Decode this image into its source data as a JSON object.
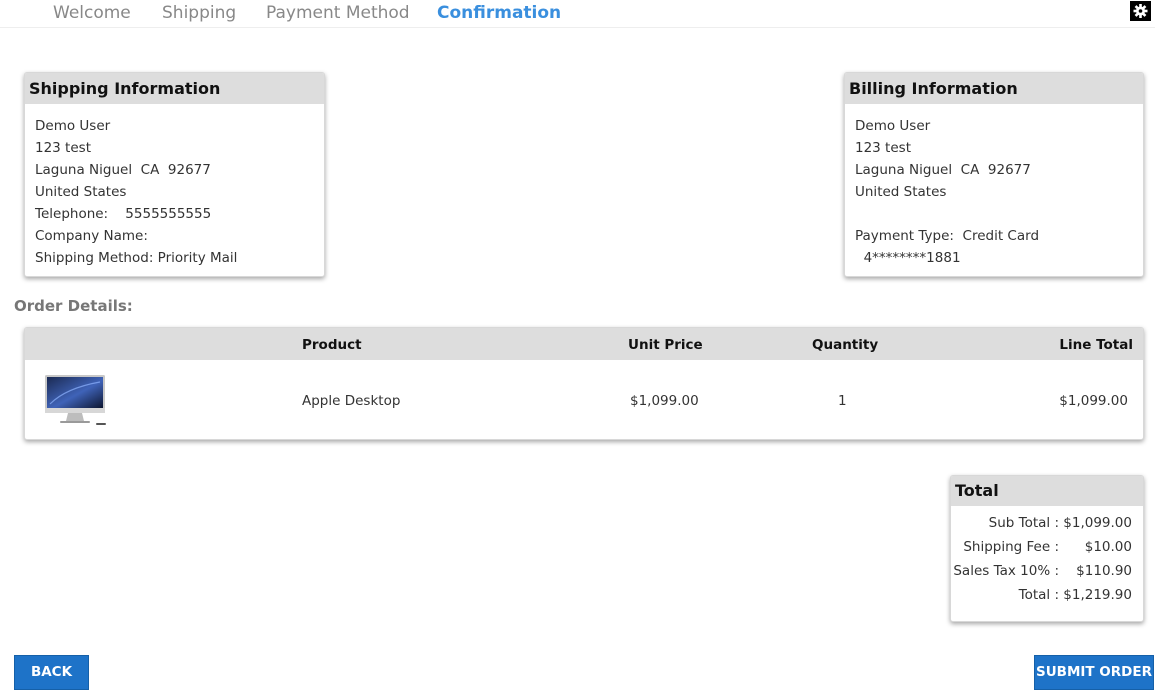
{
  "steps": [
    {
      "label": "Welcome",
      "active": false
    },
    {
      "label": "Shipping",
      "active": false
    },
    {
      "label": "Payment Method",
      "active": false
    },
    {
      "label": "Confirmation",
      "active": true
    }
  ],
  "header": {
    "settings_icon": "gear-icon"
  },
  "shipping": {
    "title": "Shipping Information",
    "name": "Demo User",
    "address": "123 test",
    "city_state_zip": "Laguna Niguel  CA  92677",
    "country": "United States",
    "telephone_label": "Telephone:",
    "telephone": "5555555555",
    "company_label": "Company Name:",
    "company": "",
    "method_label": "Shipping Method:",
    "method": "Priority Mail"
  },
  "billing": {
    "title": "Billing Information",
    "name": "Demo User",
    "address": "123 test",
    "city_state_zip": "Laguna Niguel  CA  92677",
    "country": "United States",
    "payment_type_label": "Payment Type:",
    "payment_type": "Credit Card",
    "card_number": "4********1881"
  },
  "order": {
    "title": "Order Details:",
    "columns": [
      "Product",
      "Unit Price",
      "Quantity",
      "Line Total"
    ],
    "rows": [
      {
        "image": "desktop-computer-image",
        "product": "Apple Desktop",
        "unit_price": "$1,099.00",
        "quantity": "1",
        "line_total": "$1,099.00"
      }
    ]
  },
  "totals": {
    "title": "Total",
    "rows": [
      {
        "label": "Sub Total :",
        "value": "$1,099.00"
      },
      {
        "label": "Shipping Fee :",
        "value": "$10.00"
      },
      {
        "label": "Sales Tax 10% :",
        "value": "$110.90"
      },
      {
        "label": "Total :",
        "value": "$1,219.90"
      }
    ]
  },
  "actions": {
    "back_label": "BACK",
    "submit_label": "SUBMIT ORDER"
  },
  "colors": {
    "accent": "#3a8fde",
    "button": "#1e73c8",
    "card_header": "#dddddd"
  }
}
